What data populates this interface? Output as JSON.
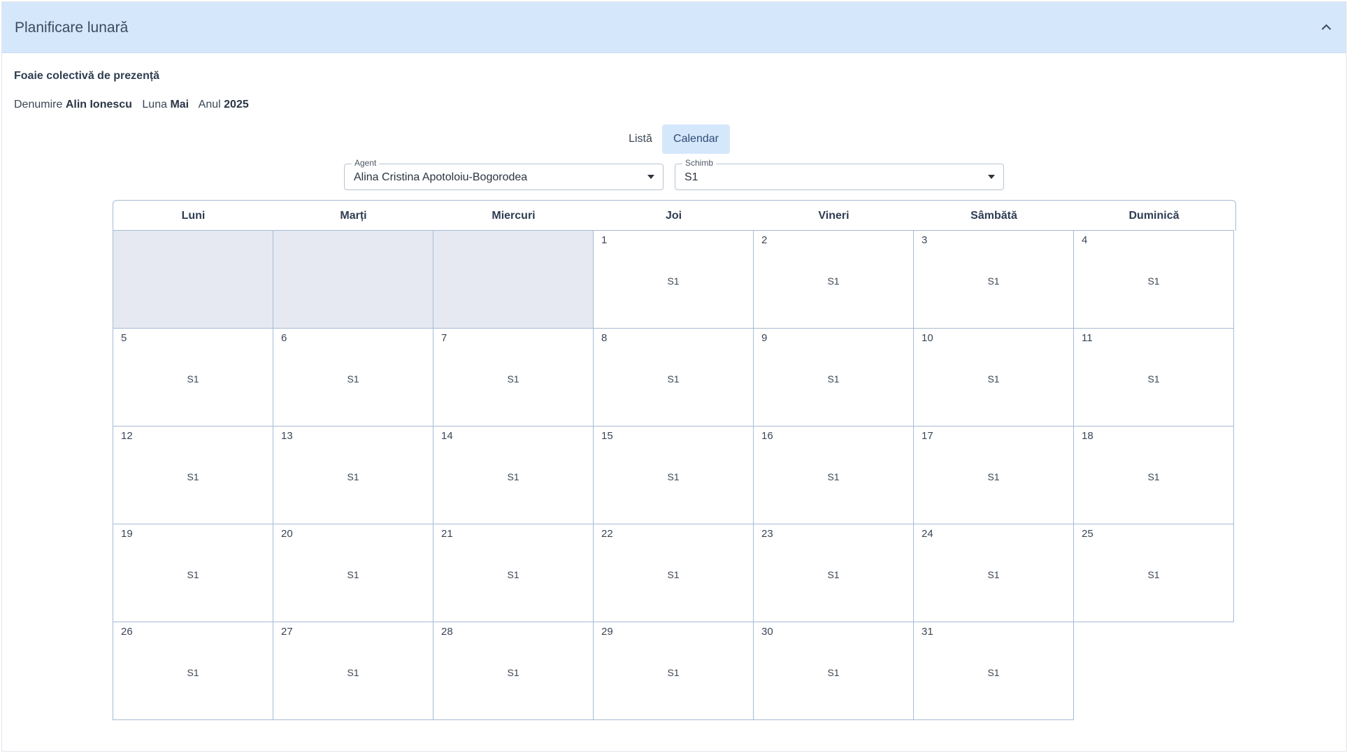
{
  "header": {
    "title": "Planificare lunară",
    "collapse_icon": "chevron-up-icon"
  },
  "section": {
    "title": "Foaie colectivă de prezență"
  },
  "meta": {
    "name_label": "Denumire",
    "name_value": "Alin Ionescu",
    "month_label": "Luna",
    "month_value": "Mai",
    "year_label": "Anul",
    "year_value": "2025"
  },
  "view_toggle": {
    "list_label": "Listă",
    "calendar_label": "Calendar",
    "active": "Calendar"
  },
  "filters": {
    "agent": {
      "label": "Agent",
      "value": "Alina Cristina Apotoloiu-Bogorodea"
    },
    "shift": {
      "label": "Schimb",
      "value": "S1"
    }
  },
  "calendar": {
    "weekdays": [
      "Luni",
      "Marți",
      "Miercuri",
      "Joi",
      "Vineri",
      "Sâmbătă",
      "Duminică"
    ],
    "leading_empty": 3,
    "days": [
      {
        "day": "1",
        "shift": "S1"
      },
      {
        "day": "2",
        "shift": "S1"
      },
      {
        "day": "3",
        "shift": "S1"
      },
      {
        "day": "4",
        "shift": "S1"
      },
      {
        "day": "5",
        "shift": "S1"
      },
      {
        "day": "6",
        "shift": "S1"
      },
      {
        "day": "7",
        "shift": "S1"
      },
      {
        "day": "8",
        "shift": "S1"
      },
      {
        "day": "9",
        "shift": "S1"
      },
      {
        "day": "10",
        "shift": "S1"
      },
      {
        "day": "11",
        "shift": "S1"
      },
      {
        "day": "12",
        "shift": "S1"
      },
      {
        "day": "13",
        "shift": "S1"
      },
      {
        "day": "14",
        "shift": "S1"
      },
      {
        "day": "15",
        "shift": "S1"
      },
      {
        "day": "16",
        "shift": "S1"
      },
      {
        "day": "17",
        "shift": "S1"
      },
      {
        "day": "18",
        "shift": "S1"
      },
      {
        "day": "19",
        "shift": "S1"
      },
      {
        "day": "20",
        "shift": "S1"
      },
      {
        "day": "21",
        "shift": "S1"
      },
      {
        "day": "22",
        "shift": "S1"
      },
      {
        "day": "23",
        "shift": "S1"
      },
      {
        "day": "24",
        "shift": "S1"
      },
      {
        "day": "25",
        "shift": "S1"
      },
      {
        "day": "26",
        "shift": "S1"
      },
      {
        "day": "27",
        "shift": "S1"
      },
      {
        "day": "28",
        "shift": "S1"
      },
      {
        "day": "29",
        "shift": "S1"
      },
      {
        "day": "30",
        "shift": "S1"
      },
      {
        "day": "31",
        "shift": "S1"
      }
    ]
  },
  "colors": {
    "header_bg": "#d5e7fb",
    "grid_border": "#a7bbd4",
    "empty_cell": "#e6e9f1"
  }
}
